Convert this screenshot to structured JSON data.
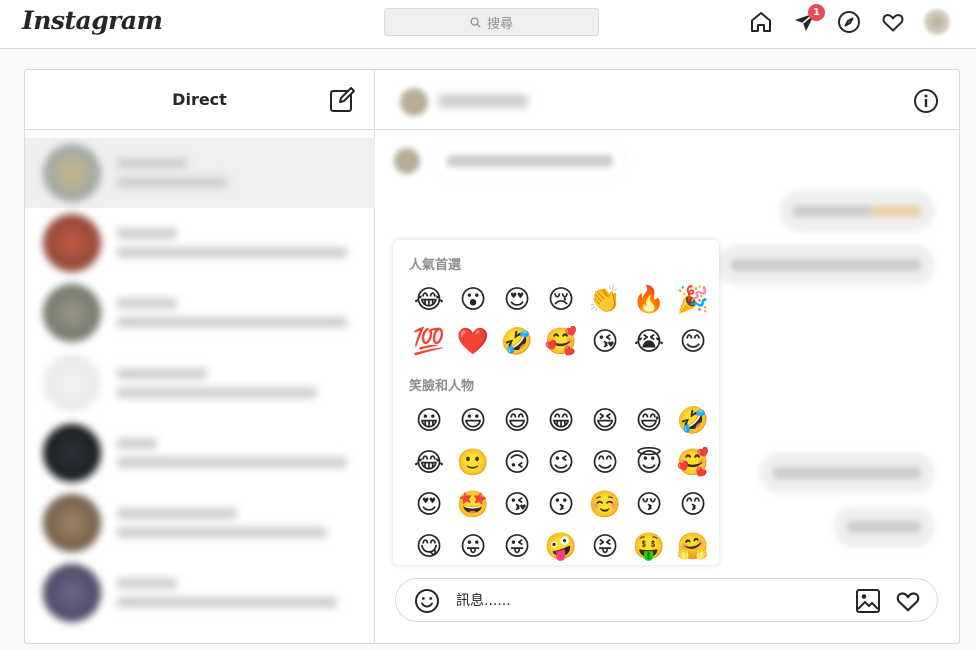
{
  "brand": "Instagram",
  "search": {
    "placeholder": "搜尋"
  },
  "nav": {
    "notification_count": "1"
  },
  "inbox": {
    "title": "Direct"
  },
  "emoji_picker": {
    "sections": [
      {
        "title": "人氣首選",
        "emojis": [
          "😂",
          "😮",
          "😍",
          "😢",
          "👏",
          "🔥",
          "🎉",
          "💯",
          "❤️",
          "🤣",
          "🥰",
          "😘",
          "😭",
          "😊"
        ]
      },
      {
        "title": "笑臉和人物",
        "emojis": [
          "😀",
          "😃",
          "😄",
          "😁",
          "😆",
          "😅",
          "🤣",
          "😂",
          "🙂",
          "🙃",
          "😉",
          "😊",
          "😇",
          "🥰",
          "😍",
          "🤩",
          "😘",
          "😗",
          "☺️",
          "😚",
          "😙",
          "😋",
          "😛",
          "😜",
          "🤪",
          "😝",
          "🤑",
          "🤗"
        ]
      }
    ]
  },
  "composer": {
    "placeholder": "訊息......"
  }
}
